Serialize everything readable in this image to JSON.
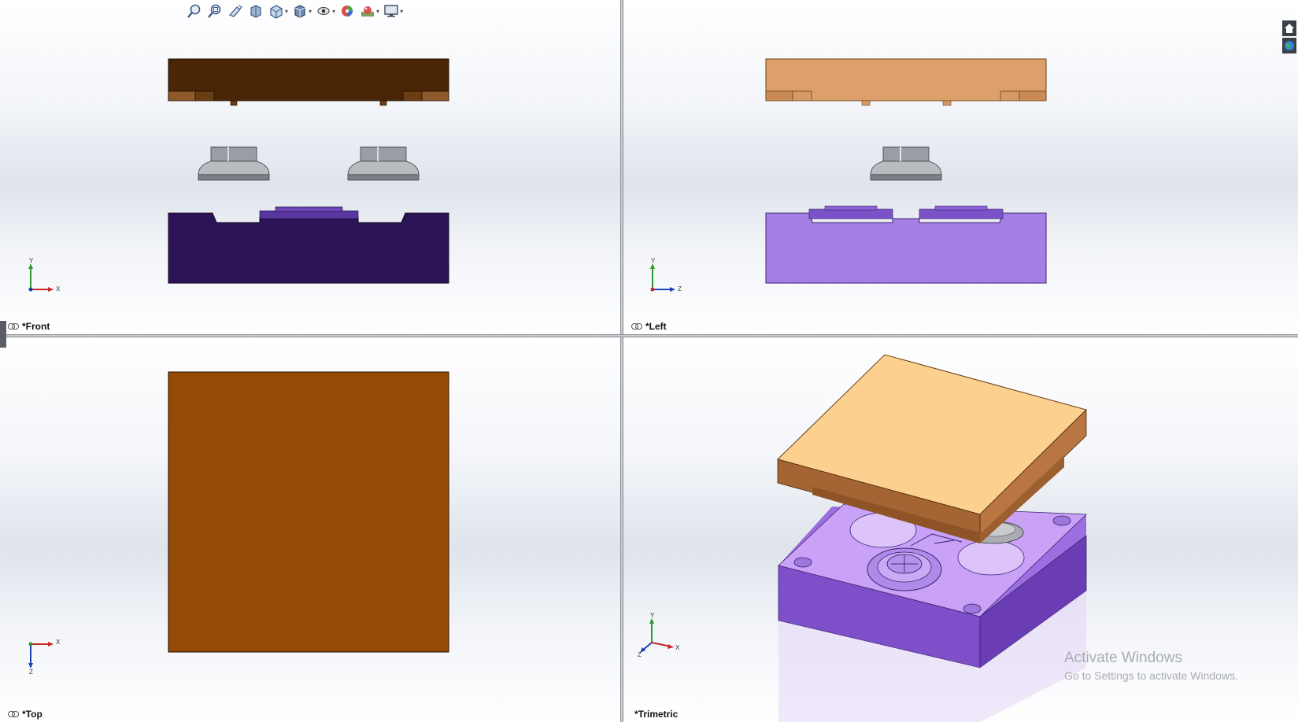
{
  "toolbar": {
    "items": [
      {
        "icon": "zoom-to-fit-icon"
      },
      {
        "icon": "zoom-to-area-icon"
      },
      {
        "icon": "previous-view-icon"
      },
      {
        "icon": "section-view-icon"
      },
      {
        "icon": "view-orientation-icon",
        "dropdown": true
      },
      {
        "icon": "display-style-icon",
        "dropdown": true
      },
      {
        "icon": "hide-show-items-icon",
        "dropdown": true
      },
      {
        "icon": "edit-appearance-icon"
      },
      {
        "icon": "apply-scene-icon",
        "dropdown": true
      },
      {
        "icon": "view-settings-icon",
        "dropdown": true
      }
    ]
  },
  "viewports": {
    "front": {
      "label": "*Front",
      "axis": {
        "up": "Y",
        "right": "X"
      }
    },
    "left": {
      "label": "*Left",
      "axis": {
        "up": "Y",
        "right": "Z"
      }
    },
    "top": {
      "label": "*Top",
      "axis": {
        "up": "X",
        "down": "Z"
      }
    },
    "trimetric": {
      "label": "*Trimetric",
      "axis": {
        "up": "Y",
        "right": "X",
        "front": "Z"
      }
    }
  },
  "colors": {
    "cavity_front": "#4a2606",
    "cavity_left": "#dea06a",
    "cavity_top": "#954a05",
    "core_front": "#2c1358",
    "core_left": "#a57ee6",
    "core_trimetric": "#b38af0",
    "part_gray": "#8e9196"
  },
  "right_panel_icons": [
    "home-view-icon",
    "appearance-globe-icon"
  ],
  "watermark": {
    "line1": "Activate Windows",
    "line2": "Go to Settings to activate Windows."
  }
}
